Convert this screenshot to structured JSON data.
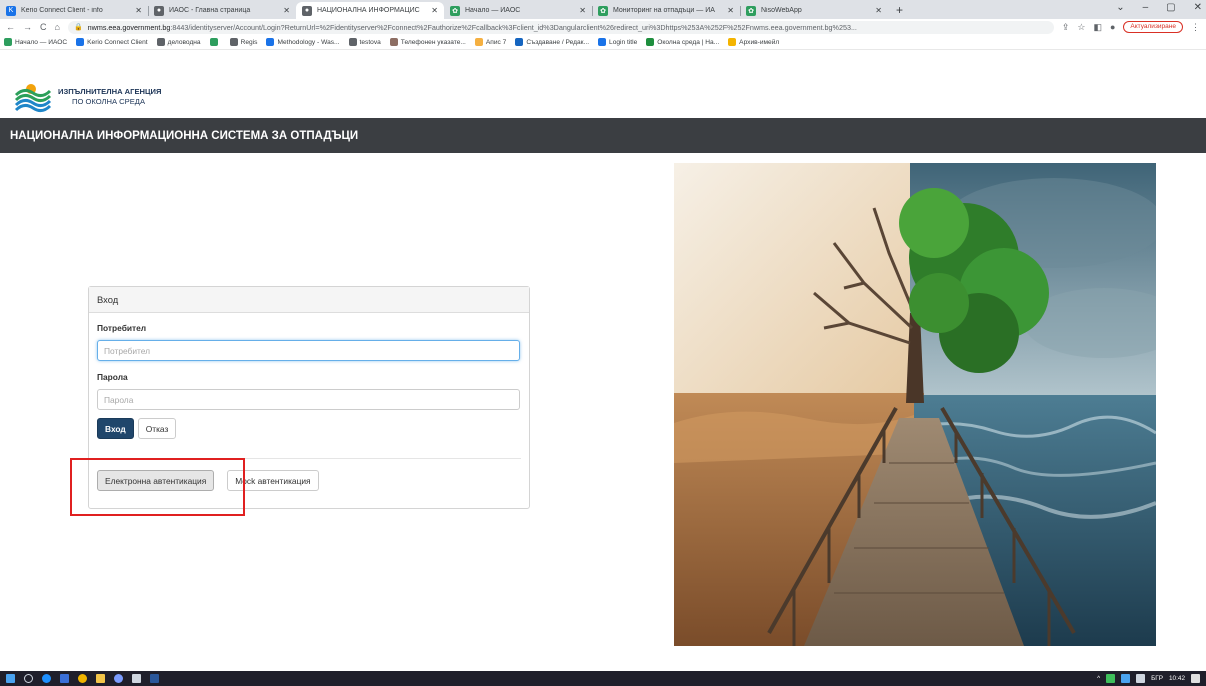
{
  "browser": {
    "tabs": [
      {
        "title": "Kerio Connect Client - info",
        "active": false,
        "fav": "K",
        "color": "#1a73e8"
      },
      {
        "title": "ИАОС - Главна страница",
        "active": false,
        "fav": "●",
        "color": "#5f6368"
      },
      {
        "title": "НАЦИОНАЛНА ИНФОРМАЦИС",
        "active": true,
        "fav": "●",
        "color": "#5f6368"
      },
      {
        "title": "Начало — ИАОС",
        "active": false,
        "fav": "✿",
        "color": "#2e9e5e"
      },
      {
        "title": "Мониторинг на отпадъци — ИА",
        "active": false,
        "fav": "✿",
        "color": "#2e9e5e"
      },
      {
        "title": "NisoWebApp",
        "active": false,
        "fav": "✿",
        "color": "#2e9e5e"
      }
    ],
    "url_host": "nwms.eea.government.bg",
    "url_path": ":8443/identityserver/Account/Login?ReturnUrl=%2Fidentityserver%2Fconnect%2Fauthorize%2Fcallback%3Fclient_id%3Dangularclient%26redirect_uri%3Dhttps%253A%252F%252Fnwms.eea.government.bg%253...",
    "update_label": "Актуализиране",
    "bookmarks": [
      {
        "label": "Начало — ИАОС",
        "color": "#2e9e5e"
      },
      {
        "label": "Kerio Connect Client",
        "color": "#1a73e8"
      },
      {
        "label": "деловодна",
        "color": "#5f6368"
      },
      {
        "label": "",
        "color": "#2e9e5e"
      },
      {
        "label": "Regis",
        "color": "#5f6368"
      },
      {
        "label": "Methodology - Was...",
        "color": "#1a73e8"
      },
      {
        "label": "testova",
        "color": "#5f6368"
      },
      {
        "label": "Телефонен указате...",
        "color": "#8d6e63"
      },
      {
        "label": "Апис 7",
        "color": "#f5b041"
      },
      {
        "label": "Създаване / Редак...",
        "color": "#1565c0"
      },
      {
        "label": "Login title",
        "color": "#1a73e8"
      },
      {
        "label": "Околна среда | На...",
        "color": "#1e8e3e"
      },
      {
        "label": "Архив-имейл",
        "color": "#f4b400"
      }
    ]
  },
  "brand": {
    "line1": "ИЗПЪЛНИТЕЛНА АГЕНЦИЯ",
    "line2": "ПО ОКОЛНА СРЕДА"
  },
  "site": {
    "title": "НАЦИОНАЛНА ИНФОРМАЦИОННА СИСТЕМА ЗА ОТПАДЪЦИ"
  },
  "login": {
    "heading": "Вход",
    "username_label": "Потребител",
    "username_placeholder": "Потребител",
    "username_value": "",
    "password_label": "Парола",
    "password_placeholder": "Парола",
    "password_value": "",
    "login_button": "Вход",
    "cancel_button": "Отказ",
    "eauth_button": "Електронна автентикация",
    "mock_button": "Mock автентикация"
  },
  "taskbar": {
    "lang": "БГР",
    "time": "10:42"
  },
  "colors": {
    "sitebar": "#3b3e42",
    "primary": "#20466b",
    "highlight": "#e02020"
  }
}
